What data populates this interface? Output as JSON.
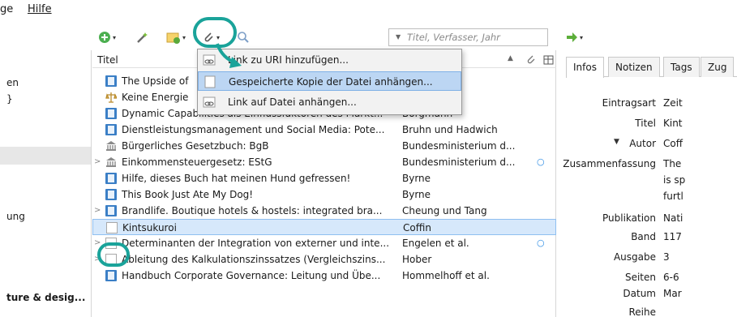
{
  "menubar": {
    "items": [
      "ge",
      "Hilfe"
    ]
  },
  "toolbar": {
    "search_placeholder": "Titel, Verfasser, Jahr"
  },
  "left": {
    "items": [
      "en",
      "}",
      "",
      "",
      "",
      "ung",
      "",
      "",
      "",
      "ture & desig..."
    ]
  },
  "table": {
    "col_title": "Titel",
    "rows": [
      {
        "title": "The Upside of",
        "creator": "",
        "icon": "book",
        "twisty": "",
        "dot": false
      },
      {
        "title": "Keine Energie",
        "creator": "",
        "icon": "law",
        "twisty": "",
        "dot": false
      },
      {
        "title": "Dynamic Capabilities als Einflussfaktoren des Markt...",
        "creator": "Borgmann",
        "icon": "book",
        "twisty": "",
        "dot": false
      },
      {
        "title": "Dienstleistungsmanagement und Social Media: Pote...",
        "creator": "Bruhn und Hadwich",
        "icon": "book",
        "twisty": "",
        "dot": false
      },
      {
        "title": "Bürgerliches Gesetzbuch: BgB",
        "creator": "Bundesministerium d...",
        "icon": "statute",
        "twisty": "",
        "dot": false
      },
      {
        "title": "Einkommensteuergesetz: EStG",
        "creator": "Bundesministerium d...",
        "icon": "statute",
        "twisty": ">",
        "dot": true
      },
      {
        "title": "Hilfe, dieses Buch hat meinen Hund gefressen!",
        "creator": "Byrne",
        "icon": "book",
        "twisty": "",
        "dot": false
      },
      {
        "title": "This Book Just Ate My Dog!",
        "creator": "Byrne",
        "icon": "book",
        "twisty": "",
        "dot": false
      },
      {
        "title": "Brandlife. Boutique hotels & hostels: integrated bra...",
        "creator": "Cheung und Tang",
        "icon": "book",
        "twisty": ">",
        "dot": false
      },
      {
        "title": "Kintsukuroi",
        "creator": "Coffin",
        "icon": "doc",
        "twisty": "",
        "dot": false,
        "selected": true
      },
      {
        "title": "Determinanten der Integration von externer und inte...",
        "creator": "Engelen et al.",
        "icon": "doc",
        "twisty": ">",
        "dot": true
      },
      {
        "title": "Ableitung des Kalkulationszinssatzes (Vergleichszins...",
        "creator": "Hober",
        "icon": "doc",
        "twisty": ">",
        "dot": false
      },
      {
        "title": "Handbuch Corporate Governance: Leitung und Übe...",
        "creator": "Hommelhoff et al.",
        "icon": "book",
        "twisty": "",
        "dot": false
      }
    ]
  },
  "menu": {
    "items": [
      {
        "label": "Link zu URI hinzufügen...",
        "highlight": false
      },
      {
        "label": "Gespeicherte Kopie der Datei anhängen...",
        "highlight": true
      },
      {
        "label": "Link auf Datei anhängen...",
        "highlight": false
      }
    ]
  },
  "right": {
    "tabs": [
      "Infos",
      "Notizen",
      "Tags",
      "Zug"
    ],
    "fields": [
      {
        "label": "Eintragsart",
        "value": "Zeit"
      },
      {
        "label": "Titel",
        "value": "Kint"
      },
      {
        "label": "Autor",
        "value": "Coff"
      },
      {
        "label": "Zusammenfassung",
        "value": "The"
      },
      {
        "label": "",
        "value": "is sp"
      },
      {
        "label": "",
        "value": "furtl"
      },
      {
        "label": "Publikation",
        "value": "Nati"
      },
      {
        "label": "Band",
        "value": "117"
      },
      {
        "label": "Ausgabe",
        "value": "3"
      },
      {
        "label": "Seiten",
        "value": "6-6"
      },
      {
        "label": "Datum",
        "value": "Mar"
      },
      {
        "label": "Reihe",
        "value": ""
      }
    ]
  },
  "colors": {
    "highlight_ring": "#1aa39a",
    "selected_row": "#d6e8fb",
    "menu_highlight": "#bcd6f3"
  }
}
